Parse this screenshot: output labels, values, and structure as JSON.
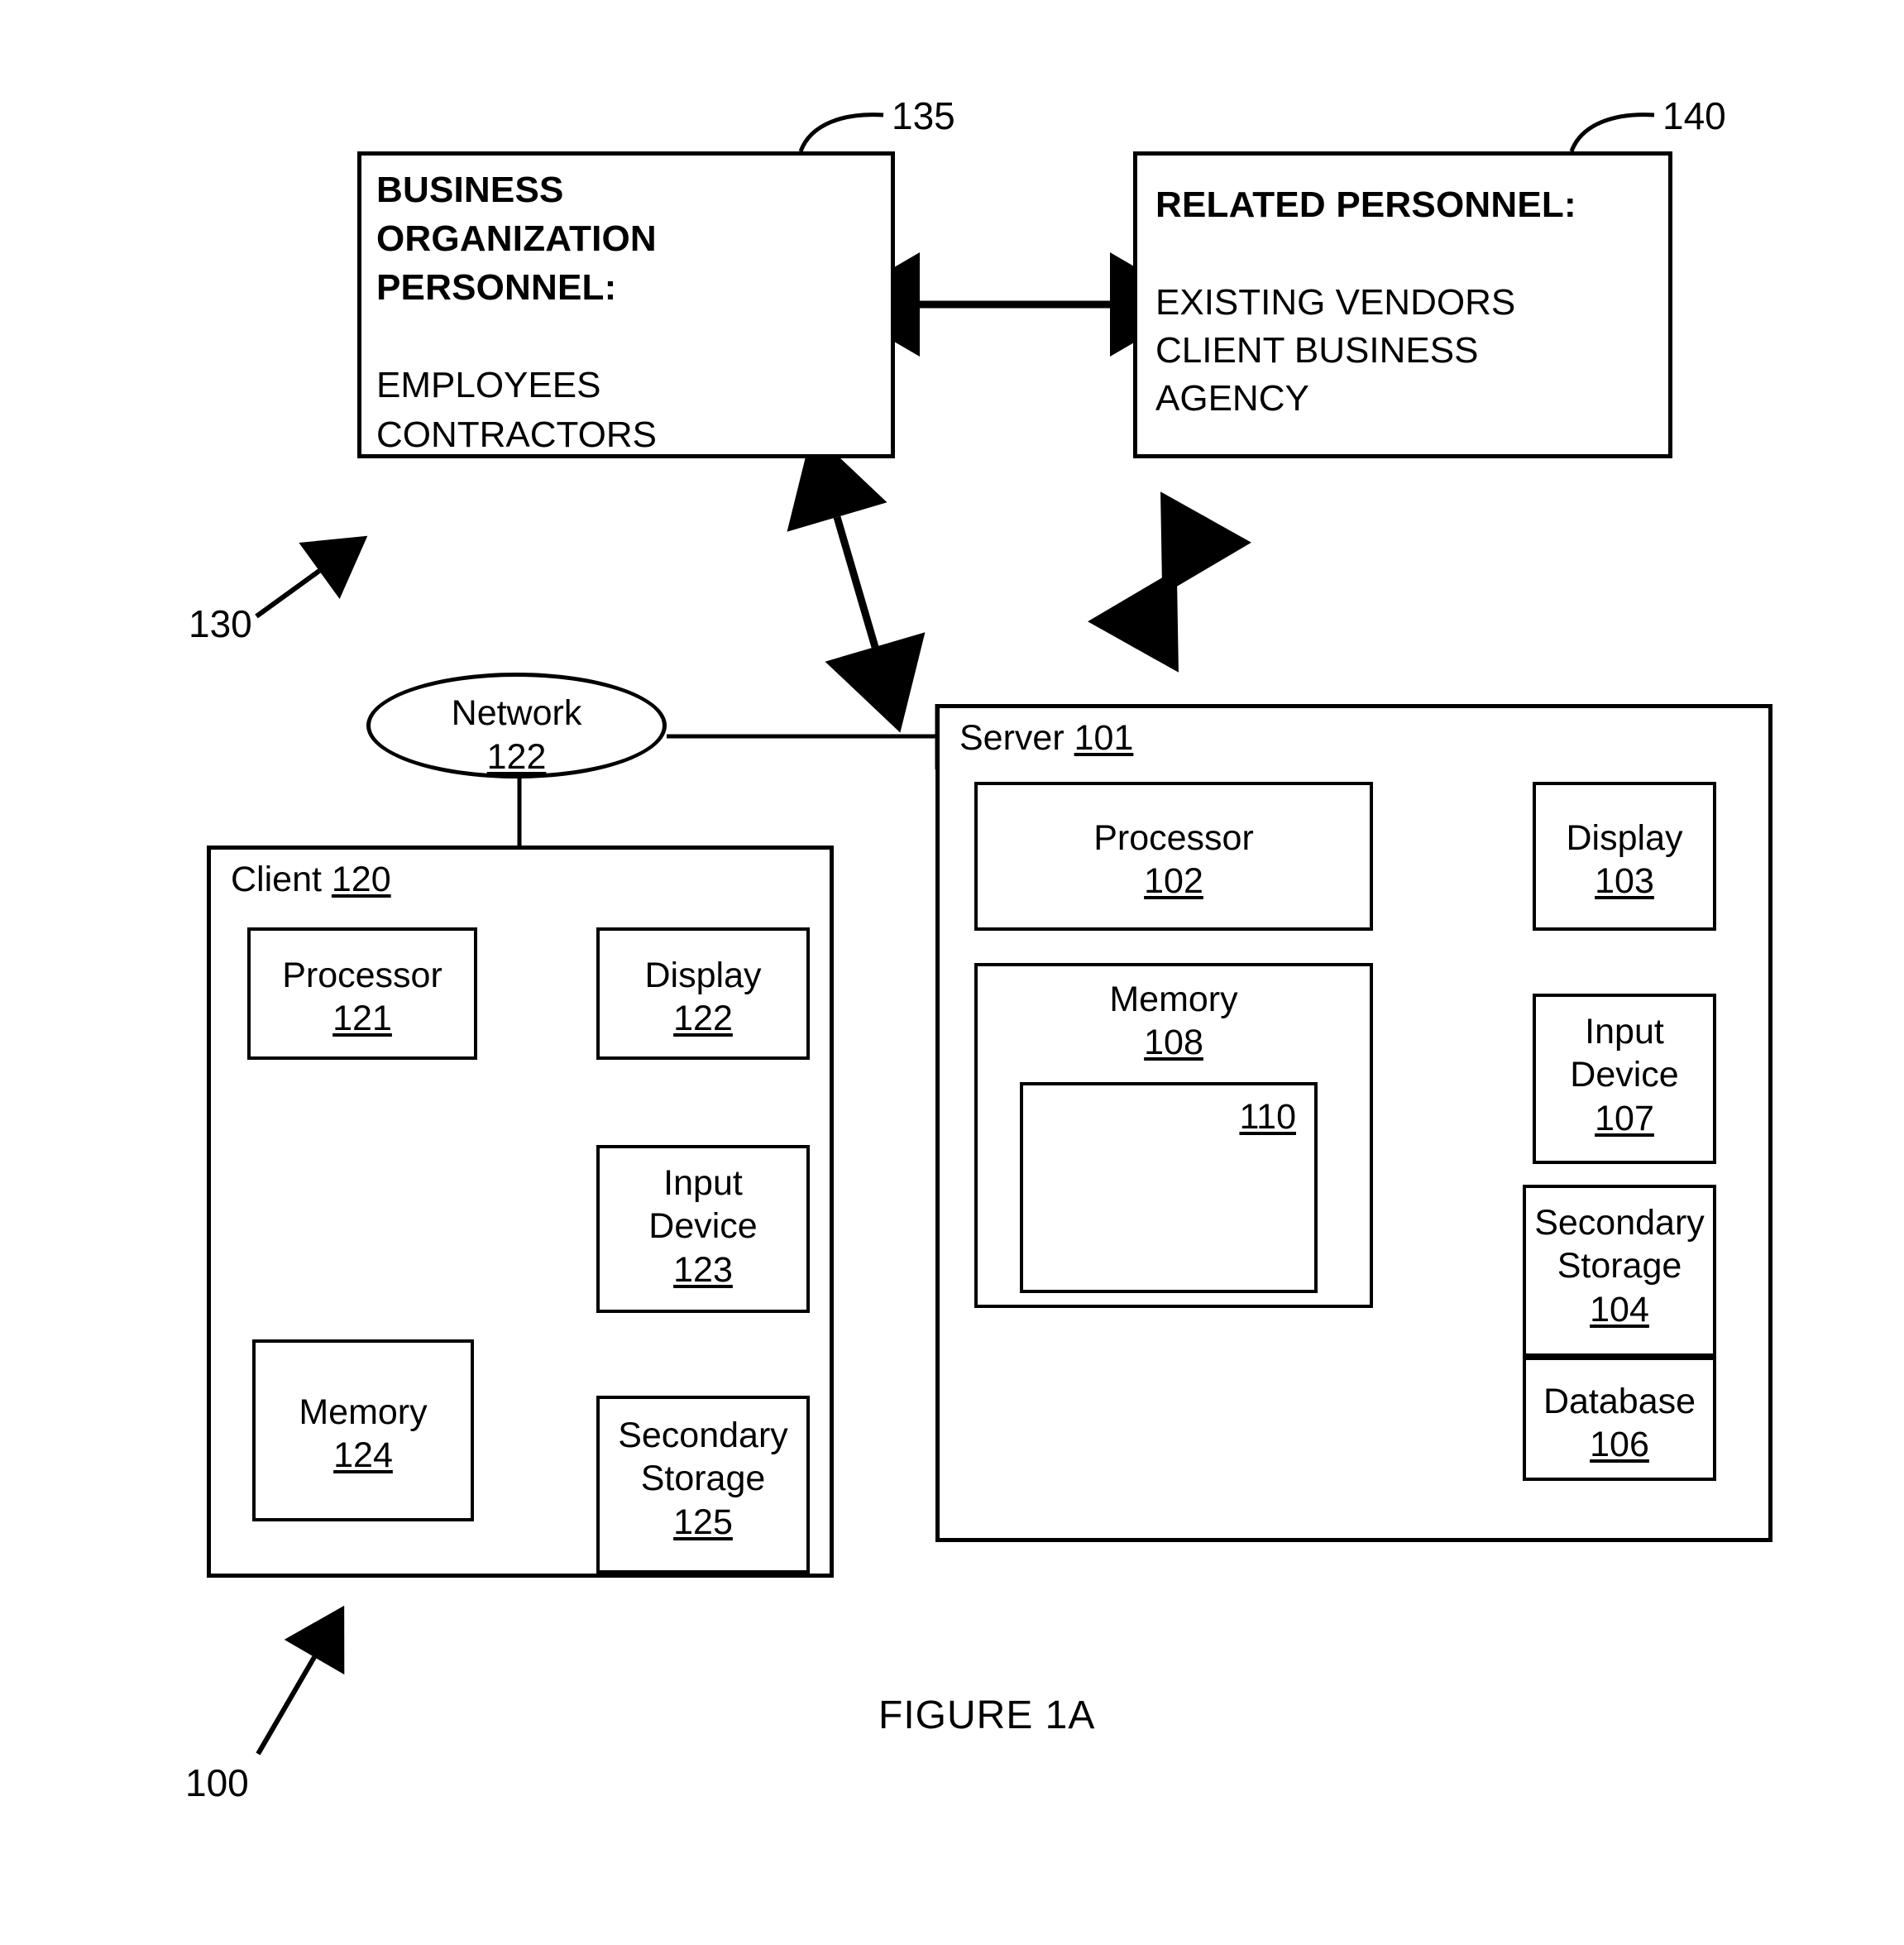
{
  "figure": {
    "caption": "FIGURE 1A",
    "system_ref": "100",
    "personnel_group_ref": "130"
  },
  "personnel": {
    "business_box": {
      "ref": "135",
      "heading_lines": [
        "BUSINESS",
        "ORGANIZATION",
        "PERSONNEL:"
      ],
      "items": [
        "EMPLOYEES",
        "CONTRACTORS"
      ]
    },
    "related_box": {
      "ref": "140",
      "heading_lines": [
        "RELATED PERSONNEL:"
      ],
      "items": [
        "EXISTING VENDORS",
        "CLIENT BUSINESS",
        "AGENCY"
      ]
    }
  },
  "network": {
    "label": "Network",
    "ref": "122"
  },
  "client": {
    "title": "Client",
    "ref": "120",
    "components": [
      {
        "name": "processor",
        "label": "Processor",
        "ref": "121"
      },
      {
        "name": "display",
        "label": "Display",
        "ref": "122"
      },
      {
        "name": "input-device",
        "label_line1": "Input",
        "label_line2": "Device",
        "ref": "123"
      },
      {
        "name": "memory",
        "label": "Memory",
        "ref": "124"
      },
      {
        "name": "secondary-storage",
        "label_line1": "Secondary",
        "label_line2": "Storage",
        "ref": "125"
      }
    ]
  },
  "server": {
    "title": "Server",
    "ref": "101",
    "components": [
      {
        "name": "processor",
        "label": "Processor",
        "ref": "102"
      },
      {
        "name": "display",
        "label": "Display",
        "ref": "103"
      },
      {
        "name": "memory",
        "label": "Memory",
        "ref": "108"
      },
      {
        "name": "memory-module",
        "ref": "110"
      },
      {
        "name": "input-device",
        "label_line1": "Input",
        "label_line2": "Device",
        "ref": "107"
      },
      {
        "name": "secondary-storage",
        "label_line1": "Secondary",
        "label_line2": "Storage",
        "ref": "104"
      },
      {
        "name": "database",
        "label": "Database",
        "ref": "106"
      }
    ]
  },
  "colors": {
    "stroke": "#000000",
    "background": "#ffffff"
  }
}
